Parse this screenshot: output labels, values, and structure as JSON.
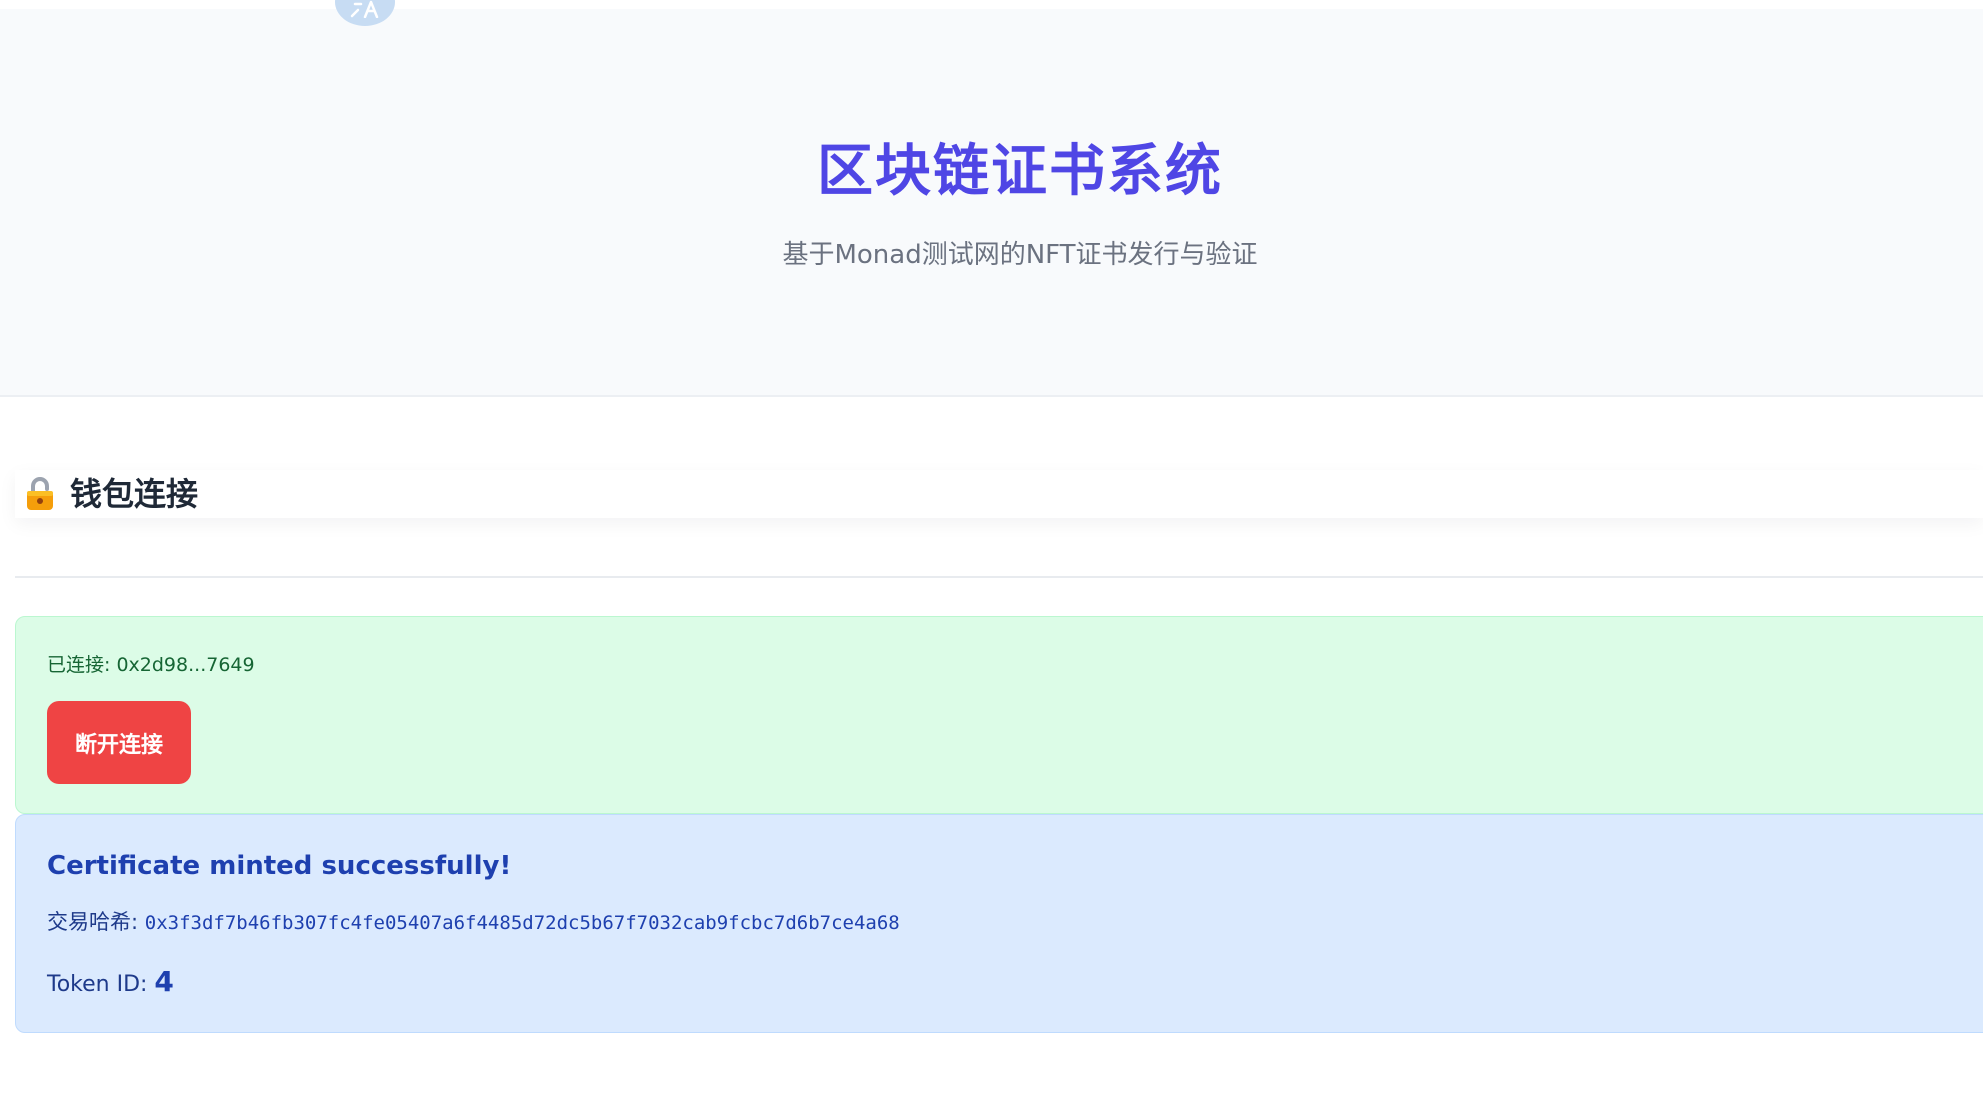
{
  "header": {
    "title": "区块链证书系统",
    "subtitle": "基于Monad测试网的NFT证书发行与验证"
  },
  "wallet_section": {
    "icon": "lock-icon",
    "title": "钱包连接",
    "status_prefix": "已连接: ",
    "address": "0x2d98...7649",
    "disconnect_label": "断开连接"
  },
  "mint_result": {
    "title": "Certificate minted successfully!",
    "tx_label": "交易哈希: ",
    "tx_hash": "0x3f3df7b46fb307fc4fe05407a6f4485d72dc5b67f7032cab9fcbc7d6b7ce4a68",
    "token_label": "Token ID: ",
    "token_id": "4"
  },
  "colors": {
    "accent": "#4f46e5",
    "success_bg": "#dcfce7",
    "info_bg": "#dbeafe",
    "danger": "#ef4444"
  }
}
